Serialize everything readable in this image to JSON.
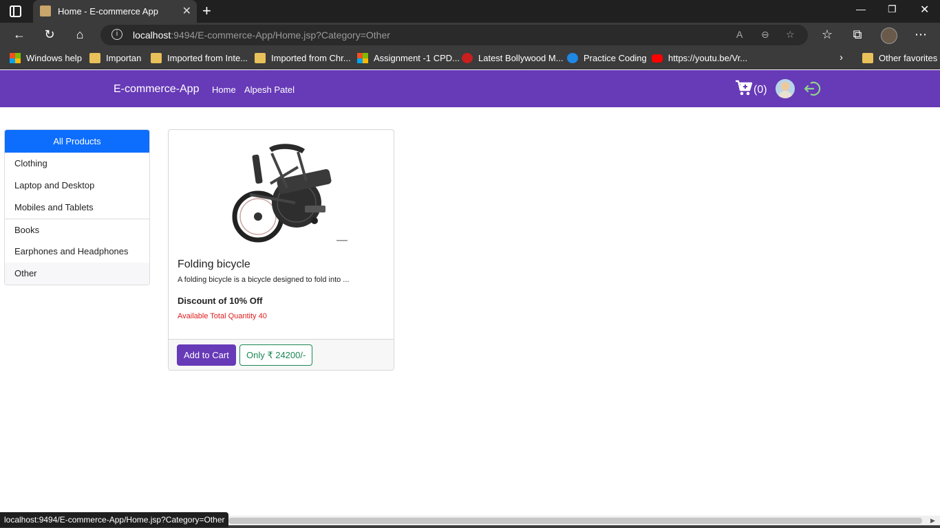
{
  "browser": {
    "tab_title": "Home - E-commerce App",
    "tab_close": "✕",
    "new_tab": "+",
    "url_host": "localhost",
    "url_rest": ":9494/E-commerce-App/Home.jsp?Category=Other",
    "status_url": "localhost:9494/E-commerce-App/Home.jsp?Category=Other",
    "bookmarks": [
      "Windows help",
      "Importan",
      "Imported from Inte...",
      "Imported from Chr...",
      "Assignment -1 CPD...",
      "Latest Bollywood M...",
      "Practice Coding",
      "https://youtu.be/Vr..."
    ],
    "other_favorites": "Other favorites"
  },
  "app": {
    "brand": "E-commerce-App",
    "nav": [
      "Home",
      "Alpesh Patel"
    ],
    "cart_count": "(0)",
    "accent_color": "#673ab7"
  },
  "sidebar": {
    "items": [
      "All Products",
      "Clothing",
      "Laptop and Desktop",
      "Mobiles and Tablets",
      "Books",
      "Earphones and Headphones",
      "Other"
    ],
    "active_color": "#0d6efd"
  },
  "product": {
    "title": "Folding bicycle",
    "description": "A folding bicycle is a bicycle designed to fold into ...",
    "discount": "Discount of 10% Off",
    "quantity": "Available Total Quantity 40",
    "add_to_cart": "Add to Cart",
    "price": "Only ₹ 24200/-",
    "image_icon": "folding-bicycle-image"
  }
}
